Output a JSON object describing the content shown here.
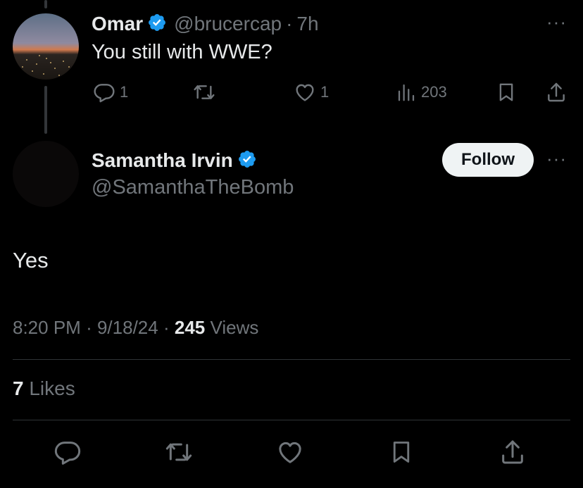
{
  "reply_tweet": {
    "author_name": "Omar",
    "author_handle": "@brucercap",
    "separator": "·",
    "time": "7h",
    "text": "You still with WWE?",
    "more_label": "···",
    "stats": {
      "replies": "1",
      "likes": "1",
      "views": "203"
    }
  },
  "main_tweet": {
    "author_name": "Samantha Irvin",
    "author_handle": "@SamanthaTheBomb",
    "follow_label": "Follow",
    "more_label": "···",
    "text": "Yes",
    "time": "8:20 PM",
    "date": "9/18/24",
    "separator": "·",
    "views_count": "245",
    "views_label": "Views",
    "likes_count": "7",
    "likes_label": "Likes"
  },
  "icons": {
    "verified": "verified-badge-icon",
    "reply": "reply-icon",
    "retweet": "retweet-icon",
    "like": "heart-icon",
    "views": "views-chart-icon",
    "bookmark": "bookmark-icon",
    "share": "share-icon"
  },
  "colors": {
    "background": "#000000",
    "text_primary": "#e7e9ea",
    "text_muted": "#71767b",
    "verified_blue": "#1d9bf0",
    "divider": "#2f3336"
  }
}
